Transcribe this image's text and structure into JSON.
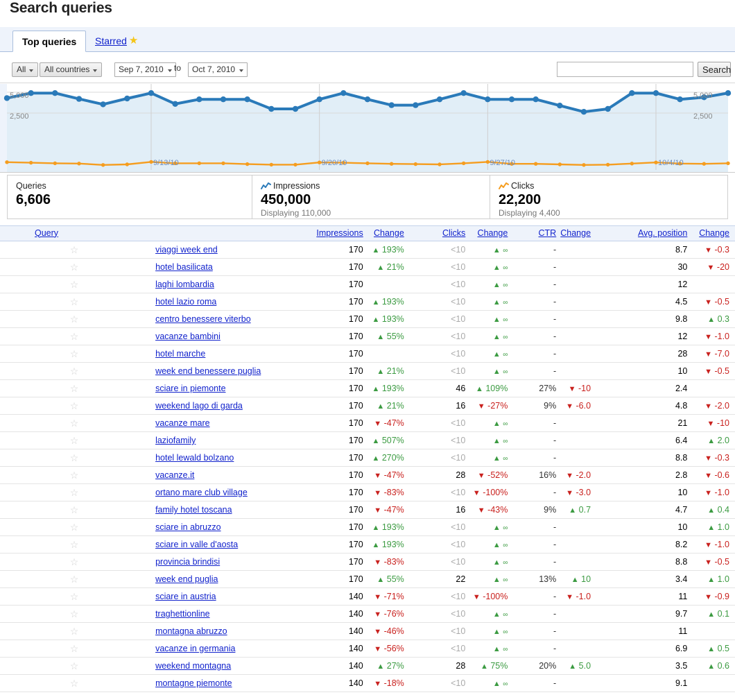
{
  "page_title": "Search queries",
  "tabs": [
    {
      "label": "Top queries",
      "active": true,
      "icon": null
    },
    {
      "label": "Starred",
      "active": false,
      "icon": "star-icon"
    }
  ],
  "toolbar": {
    "filter_all": "All",
    "filter_countries": "All countries",
    "date_from": "Sep 7, 2010",
    "to_label": "to",
    "date_to": "Oct 7, 2010",
    "search_value": "",
    "search_placeholder": "",
    "search_button": "Search"
  },
  "chart_data": {
    "type": "line",
    "title": "",
    "xlabel": "",
    "ylabel": "",
    "ylim": [
      0,
      6250
    ],
    "yticks": [
      2500,
      5000
    ],
    "ytick_labels_left": [
      "5,000",
      "2,500"
    ],
    "ytick_labels_right": [
      "5,000",
      "2,500"
    ],
    "grid": true,
    "legend_position": "none",
    "x_tick_labels": [
      "9/13/10",
      "9/20/10",
      "9/27/10",
      "10/4/10"
    ],
    "x_tick_indices": [
      6,
      13,
      20,
      27
    ],
    "x": [
      "9/7/10",
      "9/8/10",
      "9/9/10",
      "9/10/10",
      "9/11/10",
      "9/12/10",
      "9/13/10",
      "9/14/10",
      "9/15/10",
      "9/16/10",
      "9/17/10",
      "9/18/10",
      "9/19/10",
      "9/20/10",
      "9/21/10",
      "9/22/10",
      "9/23/10",
      "9/24/10",
      "9/25/10",
      "9/26/10",
      "9/27/10",
      "9/28/10",
      "9/29/10",
      "9/30/10",
      "10/1/10",
      "10/2/10",
      "10/3/10",
      "10/4/10",
      "10/5/10",
      "10/6/10",
      "10/7/10"
    ],
    "series": [
      {
        "name": "Impressions",
        "color": "#2a7ab9",
        "fill": "#e1eef7",
        "values": [
          4300,
          4900,
          4900,
          4200,
          3550,
          4250,
          4900,
          3600,
          4150,
          4150,
          4150,
          3000,
          3000,
          4150,
          4900,
          4150,
          3450,
          3450,
          4150,
          4900,
          4150,
          4150,
          4150,
          3400,
          2650,
          3000,
          4900,
          4900,
          4150,
          4400,
          4900
        ]
      },
      {
        "name": "Clicks",
        "color": "#f59d1f",
        "fill": null,
        "values": [
          230,
          210,
          190,
          180,
          130,
          150,
          240,
          190,
          190,
          190,
          160,
          140,
          140,
          220,
          210,
          190,
          170,
          160,
          150,
          190,
          240,
          170,
          170,
          150,
          130,
          140,
          180,
          220,
          180,
          170,
          190
        ]
      }
    ]
  },
  "stats": [
    {
      "label": "Queries",
      "icon": null,
      "value": "6,606",
      "sub": ""
    },
    {
      "label": "Impressions",
      "icon": "spark-blue",
      "value": "450,000",
      "sub": "Displaying 110,000"
    },
    {
      "label": "Clicks",
      "icon": "spark-orange",
      "value": "22,200",
      "sub": "Displaying 4,400"
    }
  ],
  "table": {
    "columns": [
      "Query",
      "Impressions",
      "Change",
      "Clicks",
      "Change",
      "CTR",
      "Change",
      "Avg. position",
      "Change"
    ],
    "rows": [
      {
        "query": "viaggi week end",
        "impressions": "170",
        "impr_change": "193%",
        "impr_dir": "up",
        "clicks": "<10",
        "clicks_muted": true,
        "clicks_change": "∞",
        "clicks_dir": "up",
        "ctr": "-",
        "ctr_change": "",
        "ctr_dir": "",
        "position": "8.7",
        "pos_change": "-0.3",
        "pos_dir": "down"
      },
      {
        "query": "hotel basilicata",
        "impressions": "170",
        "impr_change": "21%",
        "impr_dir": "up",
        "clicks": "<10",
        "clicks_muted": true,
        "clicks_change": "∞",
        "clicks_dir": "up",
        "ctr": "-",
        "ctr_change": "",
        "ctr_dir": "",
        "position": "30",
        "pos_change": "-20",
        "pos_dir": "down"
      },
      {
        "query": "laghi lombardia",
        "impressions": "170",
        "impr_change": "",
        "impr_dir": "",
        "clicks": "<10",
        "clicks_muted": true,
        "clicks_change": "∞",
        "clicks_dir": "up",
        "ctr": "-",
        "ctr_change": "",
        "ctr_dir": "",
        "position": "12",
        "pos_change": "",
        "pos_dir": ""
      },
      {
        "query": "hotel lazio roma",
        "impressions": "170",
        "impr_change": "193%",
        "impr_dir": "up",
        "clicks": "<10",
        "clicks_muted": true,
        "clicks_change": "∞",
        "clicks_dir": "up",
        "ctr": "-",
        "ctr_change": "",
        "ctr_dir": "",
        "position": "4.5",
        "pos_change": "-0.5",
        "pos_dir": "down"
      },
      {
        "query": "centro benessere viterbo",
        "impressions": "170",
        "impr_change": "193%",
        "impr_dir": "up",
        "clicks": "<10",
        "clicks_muted": true,
        "clicks_change": "∞",
        "clicks_dir": "up",
        "ctr": "-",
        "ctr_change": "",
        "ctr_dir": "",
        "position": "9.8",
        "pos_change": "0.3",
        "pos_dir": "up"
      },
      {
        "query": "vacanze bambini",
        "impressions": "170",
        "impr_change": "55%",
        "impr_dir": "up",
        "clicks": "<10",
        "clicks_muted": true,
        "clicks_change": "∞",
        "clicks_dir": "up",
        "ctr": "-",
        "ctr_change": "",
        "ctr_dir": "",
        "position": "12",
        "pos_change": "-1.0",
        "pos_dir": "down"
      },
      {
        "query": "hotel marche",
        "impressions": "170",
        "impr_change": "",
        "impr_dir": "",
        "clicks": "<10",
        "clicks_muted": true,
        "clicks_change": "∞",
        "clicks_dir": "up",
        "ctr": "-",
        "ctr_change": "",
        "ctr_dir": "",
        "position": "28",
        "pos_change": "-7.0",
        "pos_dir": "down"
      },
      {
        "query": "week end benessere puglia",
        "impressions": "170",
        "impr_change": "21%",
        "impr_dir": "up",
        "clicks": "<10",
        "clicks_muted": true,
        "clicks_change": "∞",
        "clicks_dir": "up",
        "ctr": "-",
        "ctr_change": "",
        "ctr_dir": "",
        "position": "10",
        "pos_change": "-0.5",
        "pos_dir": "down"
      },
      {
        "query": "sciare in piemonte",
        "impressions": "170",
        "impr_change": "193%",
        "impr_dir": "up",
        "clicks": "46",
        "clicks_muted": false,
        "clicks_change": "109%",
        "clicks_dir": "up",
        "ctr": "27%",
        "ctr_change": "-10",
        "ctr_dir": "down",
        "position": "2.4",
        "pos_change": "",
        "pos_dir": ""
      },
      {
        "query": "weekend lago di garda",
        "impressions": "170",
        "impr_change": "21%",
        "impr_dir": "up",
        "clicks": "16",
        "clicks_muted": false,
        "clicks_change": "-27%",
        "clicks_dir": "down",
        "ctr": "9%",
        "ctr_change": "-6.0",
        "ctr_dir": "down",
        "position": "4.8",
        "pos_change": "-2.0",
        "pos_dir": "down"
      },
      {
        "query": "vacanze mare",
        "impressions": "170",
        "impr_change": "-47%",
        "impr_dir": "down",
        "clicks": "<10",
        "clicks_muted": true,
        "clicks_change": "∞",
        "clicks_dir": "up",
        "ctr": "-",
        "ctr_change": "",
        "ctr_dir": "",
        "position": "21",
        "pos_change": "-10",
        "pos_dir": "down"
      },
      {
        "query": "laziofamily",
        "impressions": "170",
        "impr_change": "507%",
        "impr_dir": "up",
        "clicks": "<10",
        "clicks_muted": true,
        "clicks_change": "∞",
        "clicks_dir": "up",
        "ctr": "-",
        "ctr_change": "",
        "ctr_dir": "",
        "position": "6.4",
        "pos_change": "2.0",
        "pos_dir": "up"
      },
      {
        "query": "hotel lewald bolzano",
        "impressions": "170",
        "impr_change": "270%",
        "impr_dir": "up",
        "clicks": "<10",
        "clicks_muted": true,
        "clicks_change": "∞",
        "clicks_dir": "up",
        "ctr": "-",
        "ctr_change": "",
        "ctr_dir": "",
        "position": "8.8",
        "pos_change": "-0.3",
        "pos_dir": "down"
      },
      {
        "query": "vacanze.it",
        "impressions": "170",
        "impr_change": "-47%",
        "impr_dir": "down",
        "clicks": "28",
        "clicks_muted": false,
        "clicks_change": "-52%",
        "clicks_dir": "down",
        "ctr": "16%",
        "ctr_change": "-2.0",
        "ctr_dir": "down",
        "position": "2.8",
        "pos_change": "-0.6",
        "pos_dir": "down"
      },
      {
        "query": "ortano mare club village",
        "impressions": "170",
        "impr_change": "-83%",
        "impr_dir": "down",
        "clicks": "<10",
        "clicks_muted": true,
        "clicks_change": "-100%",
        "clicks_dir": "down",
        "ctr": "-",
        "ctr_change": "-3.0",
        "ctr_dir": "down",
        "position": "10",
        "pos_change": "-1.0",
        "pos_dir": "down"
      },
      {
        "query": "family hotel toscana",
        "impressions": "170",
        "impr_change": "-47%",
        "impr_dir": "down",
        "clicks": "16",
        "clicks_muted": false,
        "clicks_change": "-43%",
        "clicks_dir": "down",
        "ctr": "9%",
        "ctr_change": "0.7",
        "ctr_dir": "up",
        "position": "4.7",
        "pos_change": "0.4",
        "pos_dir": "up"
      },
      {
        "query": "sciare in abruzzo",
        "impressions": "170",
        "impr_change": "193%",
        "impr_dir": "up",
        "clicks": "<10",
        "clicks_muted": true,
        "clicks_change": "∞",
        "clicks_dir": "up",
        "ctr": "-",
        "ctr_change": "",
        "ctr_dir": "",
        "position": "10",
        "pos_change": "1.0",
        "pos_dir": "up"
      },
      {
        "query": "sciare in valle d'aosta",
        "impressions": "170",
        "impr_change": "193%",
        "impr_dir": "up",
        "clicks": "<10",
        "clicks_muted": true,
        "clicks_change": "∞",
        "clicks_dir": "up",
        "ctr": "-",
        "ctr_change": "",
        "ctr_dir": "",
        "position": "8.2",
        "pos_change": "-1.0",
        "pos_dir": "down"
      },
      {
        "query": "provincia brindisi",
        "impressions": "170",
        "impr_change": "-83%",
        "impr_dir": "down",
        "clicks": "<10",
        "clicks_muted": true,
        "clicks_change": "∞",
        "clicks_dir": "up",
        "ctr": "-",
        "ctr_change": "",
        "ctr_dir": "",
        "position": "8.8",
        "pos_change": "-0.5",
        "pos_dir": "down"
      },
      {
        "query": "week end puglia",
        "impressions": "170",
        "impr_change": "55%",
        "impr_dir": "up",
        "clicks": "22",
        "clicks_muted": false,
        "clicks_change": "∞",
        "clicks_dir": "up",
        "ctr": "13%",
        "ctr_change": "10",
        "ctr_dir": "up",
        "position": "3.4",
        "pos_change": "1.0",
        "pos_dir": "up"
      },
      {
        "query": "sciare in austria",
        "impressions": "140",
        "impr_change": "-71%",
        "impr_dir": "down",
        "clicks": "<10",
        "clicks_muted": true,
        "clicks_change": "-100%",
        "clicks_dir": "down",
        "ctr": "-",
        "ctr_change": "-1.0",
        "ctr_dir": "down",
        "position": "11",
        "pos_change": "-0.9",
        "pos_dir": "down"
      },
      {
        "query": "traghettionline",
        "impressions": "140",
        "impr_change": "-76%",
        "impr_dir": "down",
        "clicks": "<10",
        "clicks_muted": true,
        "clicks_change": "∞",
        "clicks_dir": "up",
        "ctr": "-",
        "ctr_change": "",
        "ctr_dir": "",
        "position": "9.7",
        "pos_change": "0.1",
        "pos_dir": "up"
      },
      {
        "query": "montagna abruzzo",
        "impressions": "140",
        "impr_change": "-46%",
        "impr_dir": "down",
        "clicks": "<10",
        "clicks_muted": true,
        "clicks_change": "∞",
        "clicks_dir": "up",
        "ctr": "-",
        "ctr_change": "",
        "ctr_dir": "",
        "position": "11",
        "pos_change": "",
        "pos_dir": ""
      },
      {
        "query": "vacanze in germania",
        "impressions": "140",
        "impr_change": "-56%",
        "impr_dir": "down",
        "clicks": "<10",
        "clicks_muted": true,
        "clicks_change": "∞",
        "clicks_dir": "up",
        "ctr": "-",
        "ctr_change": "",
        "ctr_dir": "",
        "position": "6.9",
        "pos_change": "0.5",
        "pos_dir": "up"
      },
      {
        "query": "weekend montagna",
        "impressions": "140",
        "impr_change": "27%",
        "impr_dir": "up",
        "clicks": "28",
        "clicks_muted": false,
        "clicks_change": "75%",
        "clicks_dir": "up",
        "ctr": "20%",
        "ctr_change": "5.0",
        "ctr_dir": "up",
        "position": "3.5",
        "pos_change": "0.6",
        "pos_dir": "up"
      },
      {
        "query": "montagne piemonte",
        "impressions": "140",
        "impr_change": "-18%",
        "impr_dir": "down",
        "clicks": "<10",
        "clicks_muted": true,
        "clicks_change": "∞",
        "clicks_dir": "up",
        "ctr": "-",
        "ctr_change": "",
        "ctr_dir": "",
        "position": "9.1",
        "pos_change": "",
        "pos_dir": ""
      }
    ]
  },
  "colors": {
    "impressions_line": "#2a7ab9",
    "impressions_fill": "#e1eef7",
    "clicks_line": "#f59d1f",
    "link": "#1122cc",
    "up": "#3c9b42",
    "down": "#c9211e",
    "tab_bg": "#eef3fb"
  }
}
